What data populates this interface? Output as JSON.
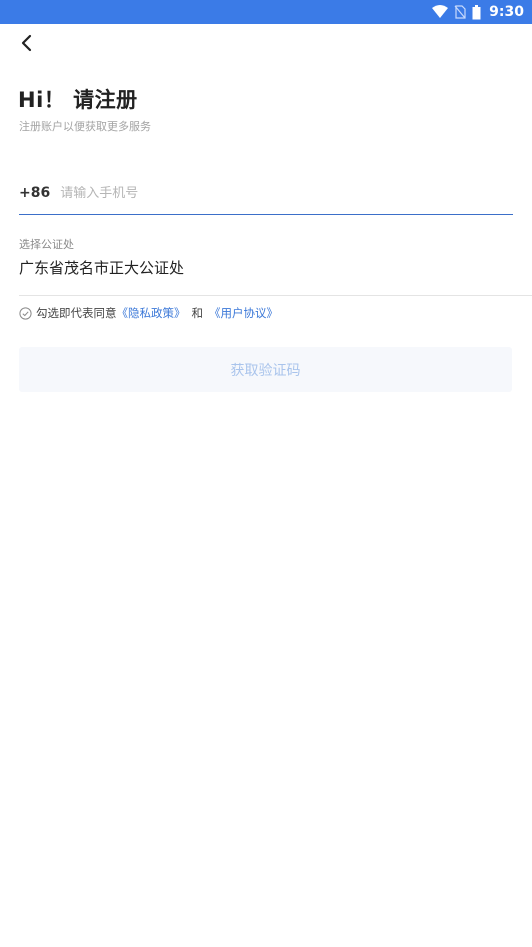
{
  "status_bar": {
    "time": "9:30",
    "icons": [
      "wifi-icon",
      "no-sim-icon",
      "battery-icon"
    ]
  },
  "header": {
    "back_icon": "chevron-left-icon"
  },
  "main": {
    "title": "Hi！ 请注册",
    "subtitle": "注册账户以便获取更多服务",
    "phone": {
      "country_code": "+86",
      "placeholder": "请输入手机号",
      "value": ""
    },
    "notary": {
      "label": "选择公证处",
      "value": "广东省茂名市正大公证处"
    },
    "agreement": {
      "check_icon": "circle-check-icon",
      "prefix": "勾选即代表同意",
      "privacy_link": "《隐私政策》",
      "and": "和",
      "terms_link": "《用户协议》"
    },
    "submit_label": "获取验证码"
  },
  "colors": {
    "status_bar_bg": "#3b7be7",
    "link": "#3b78d8",
    "input_underline": "#3b6fc9",
    "button_bg": "#f6f8fc",
    "button_text": "#a9c4ec"
  }
}
